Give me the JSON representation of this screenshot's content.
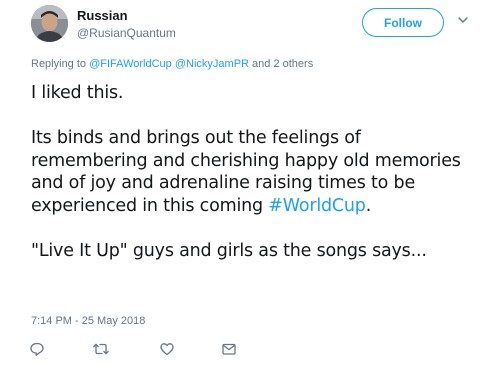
{
  "user": {
    "display_name": "Russian",
    "handle": "@RusianQuantum"
  },
  "header": {
    "follow_label": "Follow"
  },
  "reply": {
    "prefix": "Replying to ",
    "mention1": "@FIFAWorldCup",
    "mention2": "@NickyJamPR",
    "suffix": " and 2 others"
  },
  "tweet": {
    "line1": "I liked this.",
    "para2_before": "Its binds and brings out the feelings of remembering and cherishing happy old memories and of joy and adrenaline raising times to be experienced in this coming ",
    "hashtag": "#WorldCup",
    "para2_after": ".",
    "line3": "\"Live It Up\" guys and girls as the songs says..."
  },
  "timestamp": "7:14 PM - 25 May 2018",
  "icons": {
    "reply": "reply-icon",
    "retweet": "retweet-icon",
    "like": "heart-icon",
    "dm": "envelope-icon"
  },
  "colors": {
    "accent": "#1da1f2",
    "muted": "#657786",
    "text": "#14171a"
  }
}
